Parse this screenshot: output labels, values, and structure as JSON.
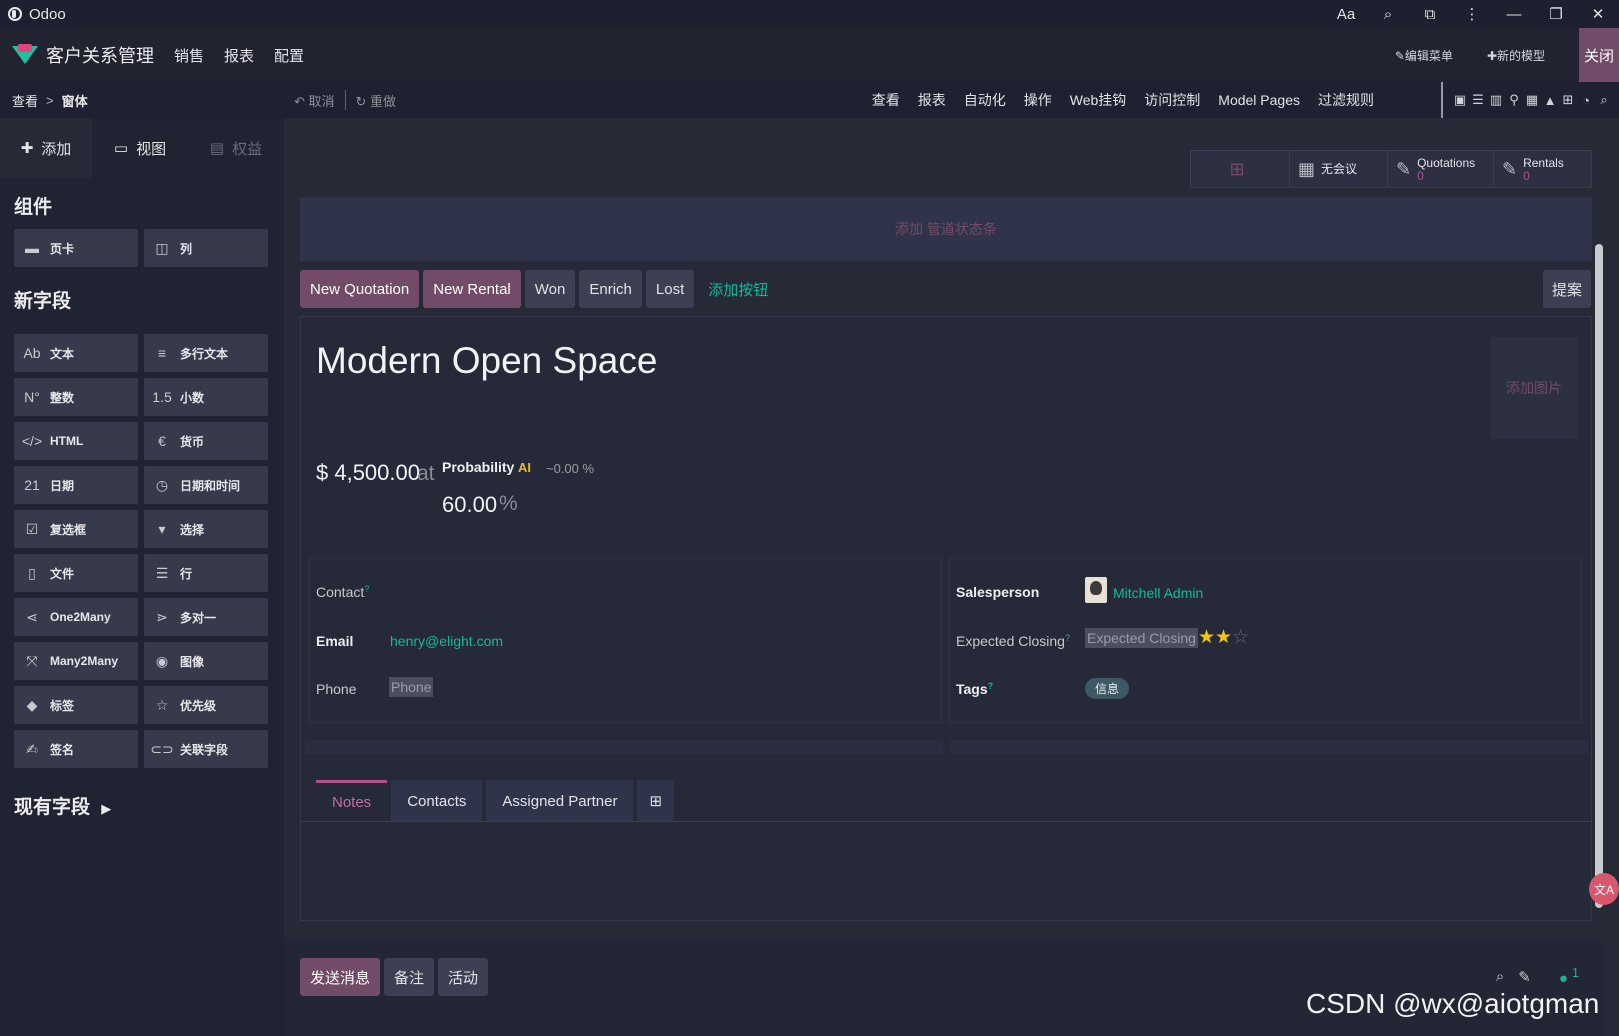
{
  "window": {
    "title": "Odoo",
    "controls": [
      "Aa",
      "⌕",
      "⧉",
      "⋮",
      "—",
      "❐",
      "✕"
    ]
  },
  "navbar": {
    "brand": "客户关系管理",
    "menus": [
      "销售",
      "报表",
      "配置"
    ],
    "edit_menu": "✎编辑菜单",
    "new_model": "✚新的模型",
    "close": "关闭"
  },
  "subbar": {
    "breadcrumb": [
      "查看",
      "窗体"
    ],
    "crumb_sep": ">",
    "undo": "↶ 取消",
    "redo": "↻ 重做",
    "menus": [
      "查看",
      "报表",
      "自动化",
      "操作",
      "Web挂钩",
      "访问控制",
      "Model Pages",
      "过滤规则"
    ]
  },
  "sidebar": {
    "tabs": [
      {
        "icon": "✚",
        "label": "添加"
      },
      {
        "icon": "▭",
        "label": "视图"
      },
      {
        "icon": "▤",
        "label": "权益"
      }
    ],
    "components_title": "组件",
    "components": [
      {
        "icon": "▬",
        "label": "页卡"
      },
      {
        "icon": "◫",
        "label": "列"
      }
    ],
    "new_fields_title": "新字段",
    "new_fields": [
      {
        "icon": "Ab",
        "label": "文本"
      },
      {
        "icon": "≡",
        "label": "多行文本"
      },
      {
        "icon": "N°",
        "label": "整数"
      },
      {
        "icon": "1.5",
        "label": "小数"
      },
      {
        "icon": "</>",
        "label": "HTML"
      },
      {
        "icon": "€",
        "label": "货币"
      },
      {
        "icon": "21",
        "label": "日期"
      },
      {
        "icon": "◷",
        "label": "日期和时间"
      },
      {
        "icon": "☑",
        "label": "复选框"
      },
      {
        "icon": "▾",
        "label": "选择"
      },
      {
        "icon": "▯",
        "label": "文件"
      },
      {
        "icon": "☰",
        "label": "行"
      },
      {
        "icon": "⋖",
        "label": "One2Many"
      },
      {
        "icon": "⋗",
        "label": "多对一"
      },
      {
        "icon": "⤧",
        "label": "Many2Many"
      },
      {
        "icon": "◉",
        "label": "图像"
      },
      {
        "icon": "◆",
        "label": "标签"
      },
      {
        "icon": "☆",
        "label": "优先级"
      },
      {
        "icon": "✍",
        "label": "签名"
      },
      {
        "icon": "⊂⊃",
        "label": "关联字段"
      }
    ],
    "existing_fields": "现有字段"
  },
  "stats": {
    "meeting": "无会议",
    "quotations": {
      "label": "Quotations",
      "count": "0"
    },
    "rentals": {
      "label": "Rentals",
      "count": "0"
    }
  },
  "pipeline_placeholder": "添加 管道状态条",
  "header_buttons": [
    "New Quotation",
    "New Rental",
    "Won",
    "Enrich",
    "Lost"
  ],
  "add_button": "添加按钮",
  "suggest": "提案",
  "record": {
    "title": "Modern Open Space",
    "add_image": "添加图片",
    "revenue": "$ 4,500.00",
    "at": "at",
    "probability_label": "Probability",
    "ai_badge": "AI",
    "ai_probability": "~0.00 %",
    "probability": "60.00",
    "percent": "%"
  },
  "fields_left": {
    "contact": "Contact",
    "email_label": "Email",
    "email": "henry@elight.com",
    "phone_label": "Phone",
    "phone_placeholder": "Phone"
  },
  "fields_right": {
    "salesperson_label": "Salesperson",
    "salesperson": "Mitchell Admin",
    "expected_closing_label": "Expected Closing",
    "expected_closing_placeholder": "Expected Closing",
    "priority_stars": 2,
    "tags_label": "Tags",
    "tag": "信息"
  },
  "notebook": {
    "tabs": [
      "Notes",
      "Contacts",
      "Assigned Partner"
    ],
    "active": "Notes"
  },
  "chatter": {
    "buttons": [
      "发送消息",
      "备注",
      "活动"
    ],
    "followers": "1"
  },
  "watermark": "CSDN @wx@aiotgman",
  "translate_fab": "文A"
}
